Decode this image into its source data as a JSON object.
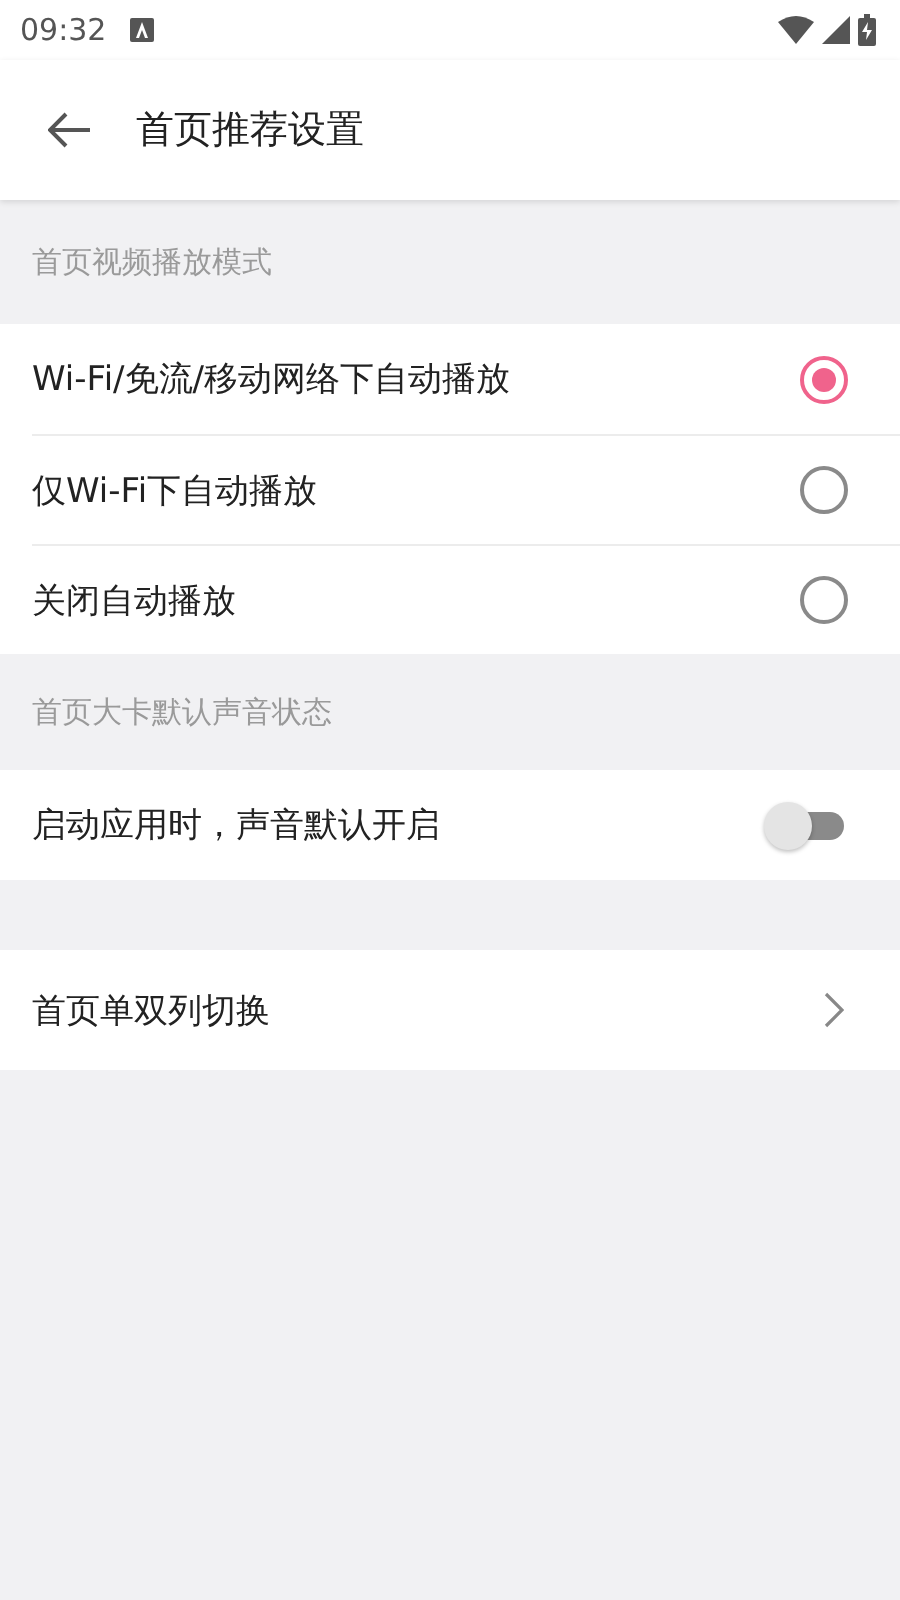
{
  "status_bar": {
    "time": "09:32"
  },
  "app_bar": {
    "title": "首页推荐设置"
  },
  "sections": [
    {
      "header": "首页视频播放模式",
      "items": [
        {
          "kind": "radio",
          "label": "Wi-Fi/免流/移动网络下自动播放",
          "selected": true
        },
        {
          "kind": "radio",
          "label": "仅Wi-Fi下自动播放",
          "selected": false
        },
        {
          "kind": "radio",
          "label": "关闭自动播放",
          "selected": false
        }
      ]
    },
    {
      "header": "首页大卡默认声音状态",
      "items": [
        {
          "kind": "toggle",
          "label": "启动应用时，声音默认开启",
          "on": false
        }
      ]
    },
    {
      "items": [
        {
          "kind": "nav",
          "label": "首页单双列切换"
        }
      ]
    }
  ]
}
